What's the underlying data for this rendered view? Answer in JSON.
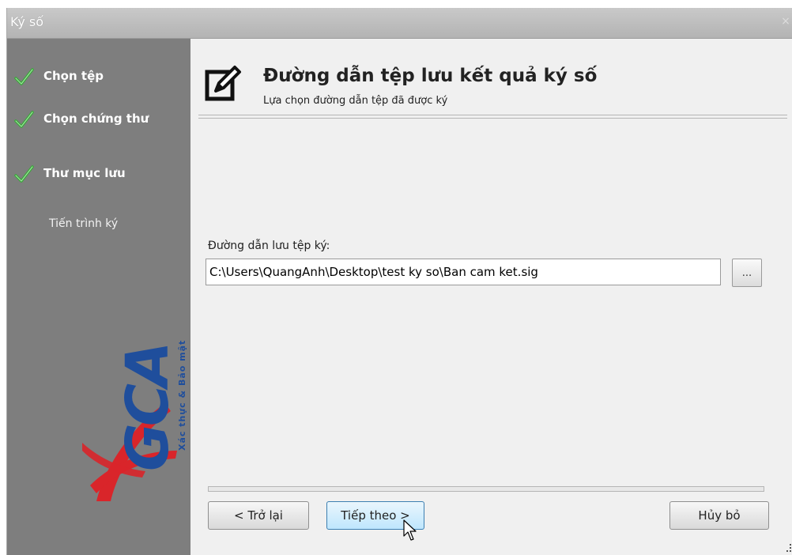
{
  "window": {
    "title": "Ký số"
  },
  "sidebar": {
    "steps": [
      {
        "label": "Chọn tệp",
        "done": true
      },
      {
        "label": "Chọn chứng thư",
        "done": true
      },
      {
        "label": "Thư mục lưu",
        "done": true
      },
      {
        "label": "Tiến trình ký",
        "done": false
      }
    ],
    "logo": {
      "text": "VGCA",
      "tagline": "Xác thực & Bảo mật",
      "colors": {
        "primary": "#1f4e9c",
        "accent": "#d9252a"
      }
    }
  },
  "header": {
    "title": "Đường dẫn tệp lưu kết quả ký số",
    "subtitle": "Lựa chọn đường dẫn tệp đã được ký",
    "icon": "edit-icon"
  },
  "form": {
    "path_label": "Đường dẫn lưu tệp ký:",
    "path_value": "C:\\Users\\QuangAnh\\Desktop\\test ky so\\Ban cam ket.sig",
    "browse_label": "..."
  },
  "buttons": {
    "back": "< Trở lại",
    "next": "Tiếp theo >",
    "cancel": "Hủy bỏ"
  },
  "colors": {
    "sidebar_bg": "#7e7e7e",
    "check_green": "#3aa53a",
    "titlebar": "#bdbdbd"
  }
}
